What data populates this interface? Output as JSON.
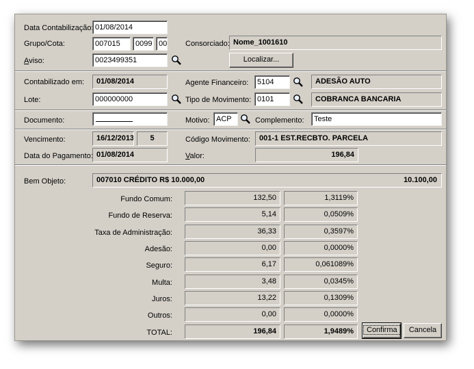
{
  "header": {
    "data_contabilizacao_label": "Data Contabilização:",
    "data_contabilizacao_value": "01/08/2014",
    "grupo_cota_label": "Grupo/Cota:",
    "grupo_value": "007015",
    "cota_value": "0099",
    "digito_value": "00",
    "consorciado_label": "Consorciado:",
    "consorciado_value": "Nome_1001610",
    "aviso_label": "Aviso:",
    "aviso_value": "0023499351",
    "localizar_label": "Localizar..."
  },
  "section2": {
    "contabilizado_label": "Contabilizado em:",
    "contabilizado_value": "01/08/2014",
    "agente_label": "Agente Financeiro:",
    "agente_code": "5104",
    "agente_name": "ADESÃO AUTO",
    "lote_label": "Lote:",
    "lote_value": "000000000",
    "tipo_mov_label": "Tipo de Movimento:",
    "tipo_mov_code": "0101",
    "tipo_mov_name": "COBRANCA BANCARIA"
  },
  "section3": {
    "documento_label": "Documento:",
    "documento_value": "",
    "motivo_label": "Motivo:",
    "motivo_value": "ACP",
    "complemento_label": "Complemento:",
    "complemento_value": "Teste"
  },
  "section4": {
    "vencimento_label": "Vencimento:",
    "vencimento_value": "16/12/2013",
    "vencimento_num": "5",
    "codigo_mov_label": "Código Movimento:",
    "codigo_mov_value": "001-1 EST.RECBTO. PARCELA",
    "data_pagamento_label": "Data do Pagamento:",
    "data_pagamento_value": "01/08/2014",
    "valor_label": "Valor:",
    "valor_value": "196,84"
  },
  "bem": {
    "label": "Bem Objeto:",
    "description": "007010 CRÉDITO R$ 10.000,00",
    "amount": "10.100,00"
  },
  "rows": [
    {
      "label": "Fundo Comum:",
      "value": "132,50",
      "percent": "1,3119%"
    },
    {
      "label": "Fundo de Reserva:",
      "value": "5,14",
      "percent": "0,0509%"
    },
    {
      "label": "Taxa de Administração:",
      "value": "36,33",
      "percent": "0,3597%"
    },
    {
      "label": "Adesão:",
      "value": "0,00",
      "percent": "0,0000%"
    },
    {
      "label": "Seguro:",
      "value": "6,17",
      "percent": "0,061089%"
    },
    {
      "label": "Multa:",
      "value": "3,48",
      "percent": "0,0345%"
    },
    {
      "label": "Juros:",
      "value": "13,22",
      "percent": "0,1309%"
    },
    {
      "label": "Outros:",
      "value": "0,00",
      "percent": "0,0000%"
    }
  ],
  "total": {
    "label": "TOTAL:",
    "value": "196,84",
    "percent": "1,9489%"
  },
  "buttons": {
    "confirma": "Confirma",
    "cancela": "Cancela"
  },
  "icons": {
    "lookup": "magnifier-icon"
  }
}
